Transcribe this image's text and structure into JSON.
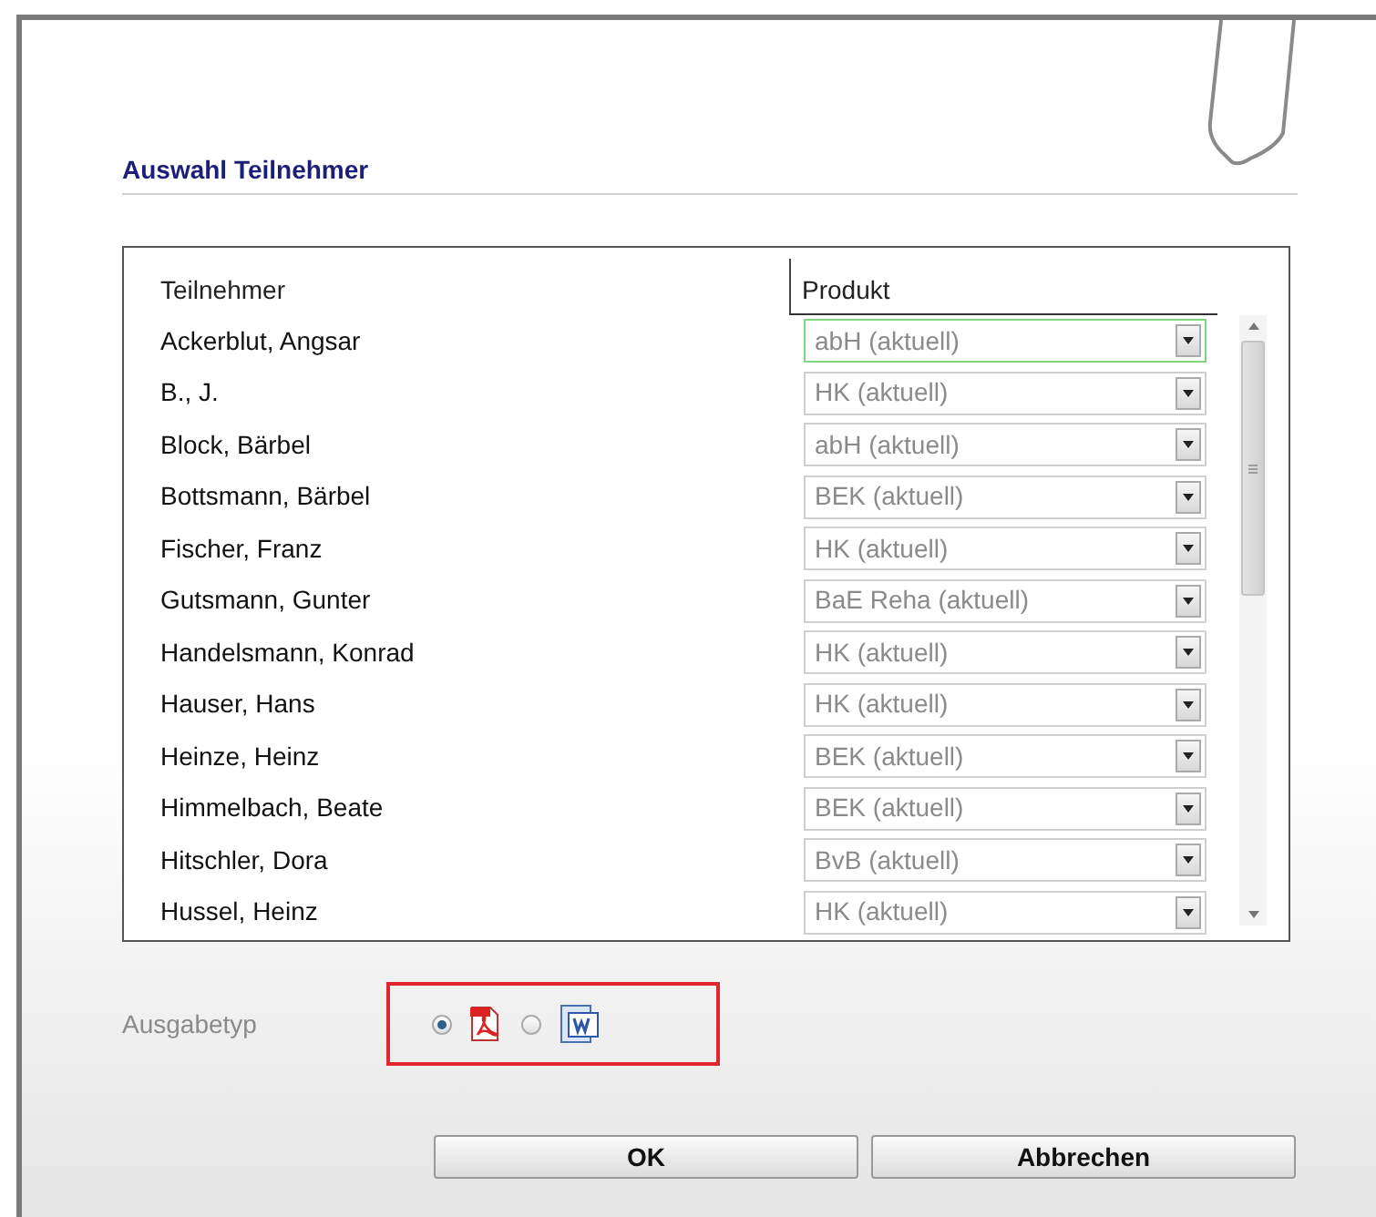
{
  "dialog": {
    "title": "Auswahl Teilnehmer"
  },
  "table": {
    "columns": [
      "Teilnehmer",
      "Produkt"
    ],
    "rows": [
      {
        "name": "Ackerblut, Angsar",
        "product": "abH (aktuell)",
        "focused": true
      },
      {
        "name": "B., J.",
        "product": "HK (aktuell)",
        "focused": false
      },
      {
        "name": "Block, Bärbel",
        "product": "abH (aktuell)",
        "focused": false
      },
      {
        "name": "Bottsmann, Bärbel",
        "product": "BEK (aktuell)",
        "focused": false
      },
      {
        "name": "Fischer, Franz",
        "product": "HK (aktuell)",
        "focused": false
      },
      {
        "name": "Gutsmann, Gunter",
        "product": "BaE Reha (aktuell)",
        "focused": false
      },
      {
        "name": "Handelsmann, Konrad",
        "product": "HK (aktuell)",
        "focused": false
      },
      {
        "name": "Hauser, Hans",
        "product": "HK (aktuell)",
        "focused": false
      },
      {
        "name": "Heinze, Heinz",
        "product": "BEK (aktuell)",
        "focused": false
      },
      {
        "name": "Himmelbach, Beate",
        "product": "BEK (aktuell)",
        "focused": false
      },
      {
        "name": "Hitschler, Dora",
        "product": "BvB (aktuell)",
        "focused": false
      },
      {
        "name": "Hussel, Heinz",
        "product": "HK (aktuell)",
        "focused": false
      }
    ]
  },
  "output": {
    "label": "Ausgabetyp",
    "options": [
      {
        "kind": "pdf",
        "selected": true
      },
      {
        "kind": "word",
        "selected": false
      }
    ]
  },
  "buttons": [
    "OK",
    "Abbrechen"
  ]
}
